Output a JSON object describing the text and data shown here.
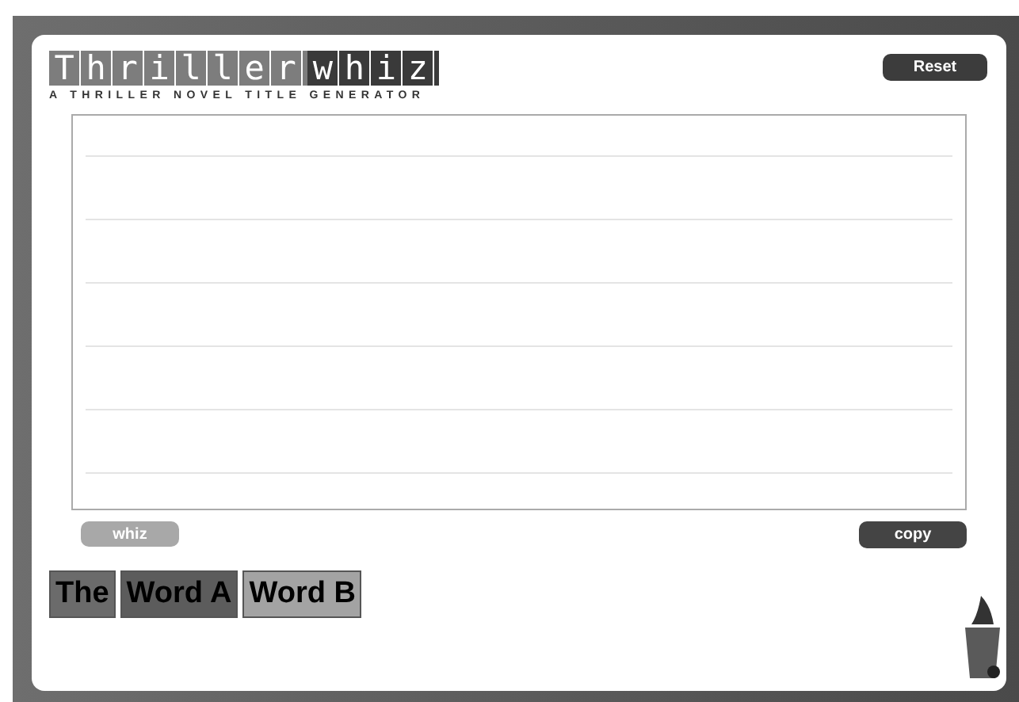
{
  "logo": {
    "words": [
      {
        "text": "Thriller",
        "kind": "light"
      },
      {
        "text": "whiz",
        "kind": "dark"
      }
    ],
    "tagline": "A THRILLER NOVEL TITLE GENERATOR"
  },
  "reset_button": "Reset",
  "whiz_button": "whiz",
  "copy_button": "copy",
  "word_tiles": [
    {
      "text": "The",
      "color": "#6b6b6b"
    },
    {
      "text": "Word A",
      "color": "#5c5c5c"
    },
    {
      "text": "Word B",
      "color": "#a3a3a3"
    }
  ]
}
